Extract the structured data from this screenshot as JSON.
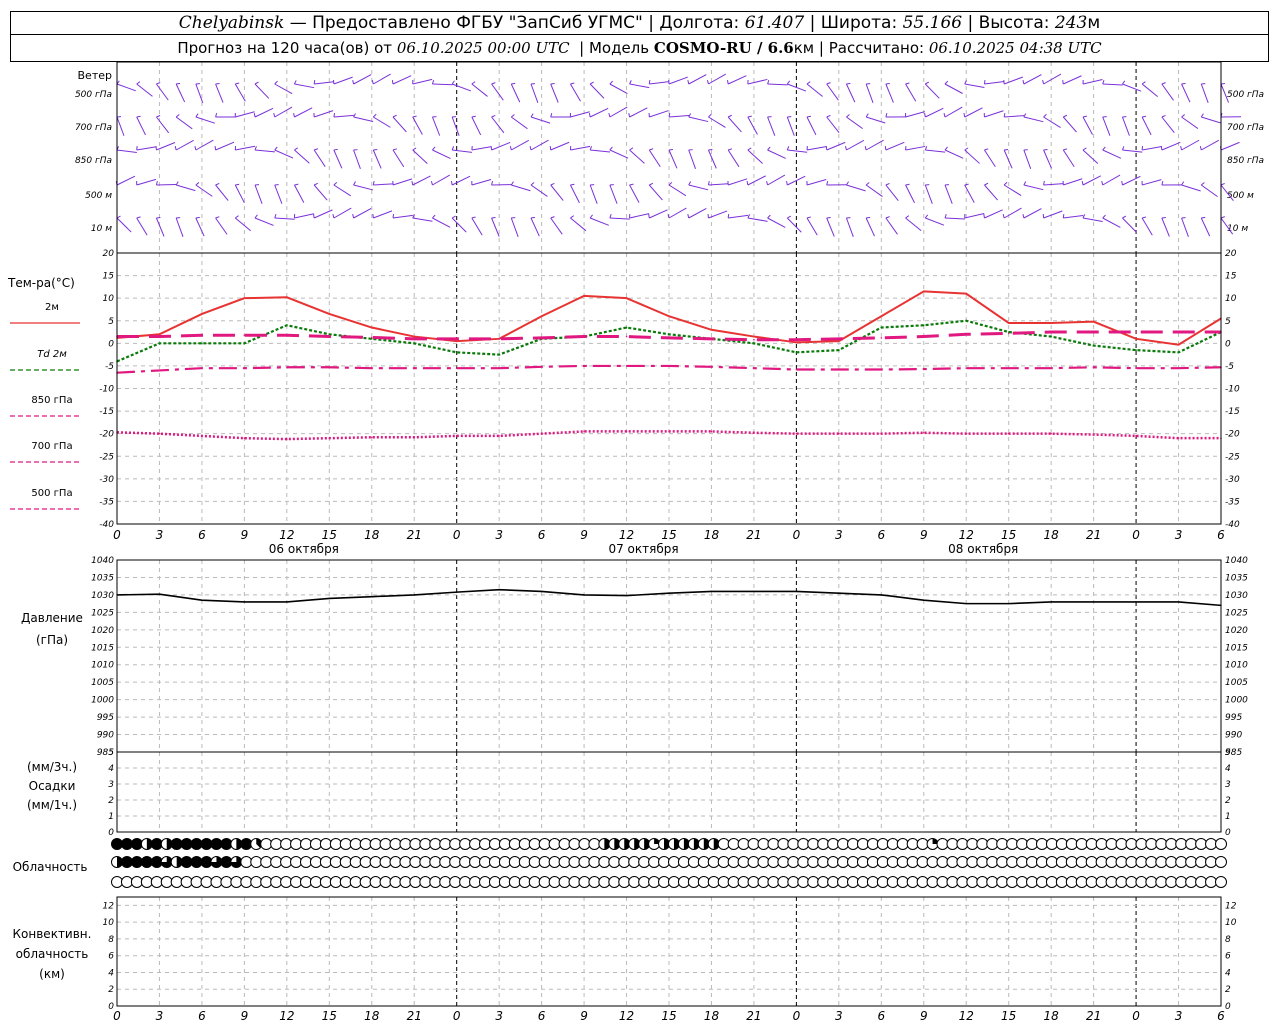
{
  "header": {
    "city": "Chelyabinsk",
    "dash": " — ",
    "provider": "Предоставлено ФГБУ \"ЗапСиб УГМС\"",
    "lon_label": "Долгота:",
    "lon": "61.407",
    "lat_label": "Широта:",
    "lat": "55.166",
    "alt_label": "Высота:",
    "alt": "243",
    "alt_unit": "м",
    "forecast_label": "Прогноз на 120 часа(ов) от",
    "start": "06.10.2025 00:00 UTC",
    "model_label": "Модель",
    "model": "COSMO-RU / 6.6",
    "model_unit": "км",
    "calc_label": "Рассчитано:",
    "calc": "06.10.2025 04:38 UTC"
  },
  "wind": {
    "title": "Ветер",
    "levels": [
      "500 гПа",
      "700 гПа",
      "850 гПа",
      "500 м",
      "10 м"
    ]
  },
  "temp_panel": {
    "title": "Тем-ра(°С)",
    "legend": [
      {
        "label": "2м",
        "color": "#e83333",
        "dash": "solid"
      },
      {
        "label": "Td 2м",
        "color": "#0a7a0a",
        "dash": "dotted"
      },
      {
        "label": "850 гПа",
        "color": "#e01880",
        "dash": "dashed"
      },
      {
        "label": "700 гПа",
        "color": "#e01880",
        "dash": "dashdot"
      },
      {
        "label": "500 гПа",
        "color": "#e01880",
        "dash": "dotted"
      }
    ],
    "yticks": [
      "20",
      "15",
      "10",
      "5",
      "0",
      "-5",
      "-10",
      "-15",
      "-20",
      "-25",
      "-30",
      "-35",
      "-40"
    ]
  },
  "pressure_panel": {
    "title": "Давление",
    "unit": "(гПа)",
    "yticks": [
      "1040",
      "1035",
      "1030",
      "1025",
      "1020",
      "1015",
      "1010",
      "1005",
      "1000",
      "995",
      "990",
      "985"
    ]
  },
  "precip_panel": {
    "unit1": "(мм/3ч.)",
    "title": "Осадки",
    "unit2": "(мм/1ч.)",
    "yticks": [
      "5",
      "4",
      "3",
      "2",
      "1",
      "0"
    ]
  },
  "cloud_panel": {
    "title": "Облачность",
    "row1": [
      8,
      8,
      8,
      4,
      8,
      4,
      8,
      8,
      8,
      8,
      8,
      8,
      4,
      8,
      3,
      0,
      0,
      0,
      0,
      0,
      0,
      0,
      0,
      0,
      0,
      0,
      0,
      0,
      0,
      0,
      0,
      0,
      0,
      0,
      0,
      0,
      0,
      0,
      0,
      0,
      0,
      0,
      0,
      0,
      0,
      0,
      0,
      0,
      0,
      4,
      4,
      4,
      4,
      4,
      2,
      4,
      4,
      4,
      4,
      4,
      4,
      0,
      0,
      0,
      0,
      0,
      0,
      0,
      0,
      0,
      0,
      0,
      0,
      0,
      0,
      0,
      0,
      0,
      0,
      0,
      0,
      0,
      2,
      0,
      0,
      0,
      0,
      0,
      0,
      0,
      0,
      0,
      0,
      0,
      0,
      0,
      0,
      0,
      0,
      0,
      0,
      0,
      0,
      0,
      0,
      0,
      0,
      0,
      0,
      0,
      0,
      0
    ],
    "row2": [
      4,
      8,
      8,
      8,
      8,
      6,
      4,
      8,
      8,
      8,
      6,
      8,
      6,
      0,
      0,
      0,
      0,
      0,
      0,
      0,
      0,
      0,
      0,
      0,
      0,
      0,
      0,
      0,
      0,
      0,
      0,
      0,
      0,
      0,
      0,
      0,
      0,
      0,
      0,
      0,
      0,
      0,
      0,
      0,
      0,
      0,
      0,
      0,
      0,
      0,
      0,
      0,
      0,
      0,
      0,
      0,
      0,
      0,
      0,
      0,
      0,
      0,
      0,
      0,
      0,
      0,
      0,
      0,
      0,
      0,
      0,
      0,
      0,
      0,
      0,
      0,
      0,
      0,
      0,
      0,
      0,
      0,
      0,
      0,
      0,
      0,
      0,
      0,
      0,
      0,
      0,
      0,
      0,
      0,
      0,
      0,
      0,
      0,
      0,
      0,
      0,
      0,
      0,
      0,
      0,
      0,
      0,
      0,
      0,
      0,
      0,
      0
    ],
    "row3_count": 112
  },
  "conv_panel": {
    "title1": "Конвективн.",
    "title2": "облачность",
    "unit": "(км)",
    "yticks": [
      "12",
      "10",
      "8",
      "6",
      "4",
      "2",
      "0"
    ]
  },
  "x_axis": {
    "hour_labels": [
      "0",
      "3",
      "6",
      "9",
      "12",
      "15",
      "18",
      "21",
      "0",
      "3",
      "6",
      "9",
      "12",
      "15",
      "18",
      "21",
      "0",
      "3",
      "6",
      "9",
      "12",
      "15",
      "18",
      "21",
      "0",
      "3",
      "6"
    ],
    "date_labels": [
      "06 октября",
      "07 октября",
      "08 октября"
    ]
  },
  "chart_data": {
    "type": "line",
    "x_hours": [
      0,
      3,
      6,
      9,
      12,
      15,
      18,
      21,
      24,
      27,
      30,
      33,
      36,
      39,
      42,
      45,
      48,
      51,
      54,
      57,
      60,
      63,
      66,
      69,
      72,
      75,
      78
    ],
    "series": [
      {
        "name": "2м",
        "values": [
          1.2,
          2.0,
          6.5,
          10.0,
          10.2,
          6.5,
          3.5,
          1.5,
          0.5,
          1.0,
          6.0,
          10.5,
          10.0,
          6.0,
          3.0,
          1.5,
          0.2,
          0.5,
          6.0,
          11.5,
          11.0,
          4.5,
          4.5,
          4.8,
          1.0,
          -0.3,
          5.5
        ]
      },
      {
        "name": "Td 2м",
        "values": [
          -4.0,
          0.0,
          0.0,
          0.0,
          4.0,
          2.0,
          1.0,
          0.0,
          -2.0,
          -2.5,
          1.0,
          1.5,
          3.5,
          2.0,
          1.0,
          0.0,
          -2.0,
          -1.5,
          3.5,
          4.0,
          5.0,
          2.5,
          1.5,
          -0.5,
          -1.5,
          -2.0,
          2.5
        ]
      },
      {
        "name": "850 гПа",
        "values": [
          1.5,
          1.5,
          1.8,
          1.8,
          1.8,
          1.5,
          1.3,
          1.0,
          1.0,
          1.0,
          1.2,
          1.5,
          1.5,
          1.2,
          1.0,
          0.8,
          0.8,
          1.0,
          1.2,
          1.5,
          2.0,
          2.2,
          2.5,
          2.5,
          2.5,
          2.5,
          2.5
        ]
      },
      {
        "name": "700 гПа",
        "values": [
          -6.5,
          -6.0,
          -5.5,
          -5.5,
          -5.3,
          -5.3,
          -5.5,
          -5.5,
          -5.5,
          -5.5,
          -5.2,
          -5.0,
          -5.0,
          -5.0,
          -5.2,
          -5.5,
          -5.8,
          -5.8,
          -5.8,
          -5.7,
          -5.5,
          -5.5,
          -5.5,
          -5.3,
          -5.5,
          -5.5,
          -5.3
        ]
      },
      {
        "name": "500 гПа",
        "values": [
          -19.7,
          -20.0,
          -20.5,
          -21.0,
          -21.2,
          -21.0,
          -20.8,
          -20.8,
          -20.5,
          -20.5,
          -20.0,
          -19.5,
          -19.5,
          -19.5,
          -19.5,
          -19.8,
          -20.0,
          -20.0,
          -20.0,
          -19.8,
          -20.0,
          -20.0,
          -20.0,
          -20.2,
          -20.5,
          -21.0,
          -21.0
        ]
      },
      {
        "name": "Давление",
        "values": [
          1030.0,
          1030.2,
          1028.5,
          1028.0,
          1028.0,
          1029.0,
          1029.5,
          1030.0,
          1030.8,
          1031.5,
          1031.0,
          1030.0,
          1029.8,
          1030.5,
          1031.0,
          1031.0,
          1031.0,
          1030.5,
          1030.0,
          1028.5,
          1027.5,
          1027.5,
          1028.0,
          1028.0,
          1028.0,
          1028.0,
          1027.0
        ]
      }
    ],
    "temp_ylim": [
      -40,
      20
    ],
    "pressure_ylim": [
      985,
      1040
    ],
    "precip_ylim": [
      0,
      5
    ],
    "conv_ylim": [
      0,
      13
    ],
    "grid": true
  }
}
